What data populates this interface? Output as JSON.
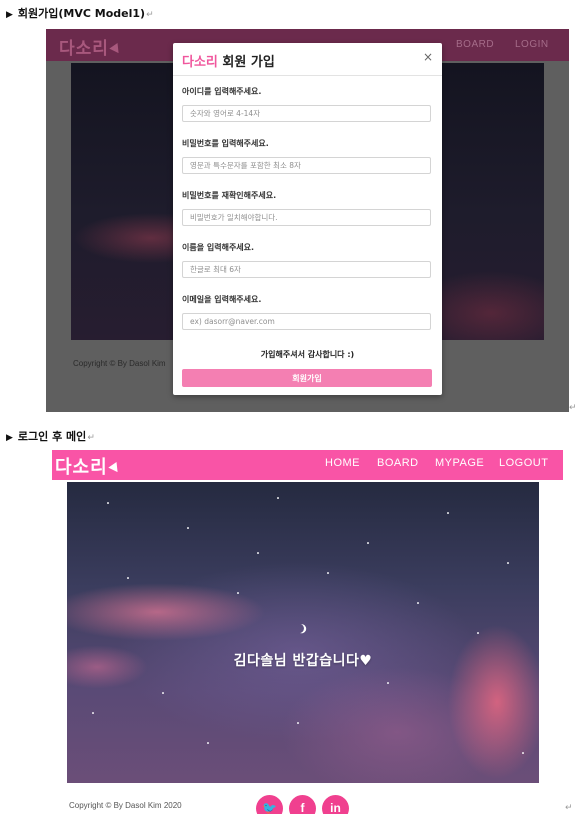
{
  "sections": {
    "signup_heading": "회원가입(MVC Model1)",
    "main_heading": "로그인 후 메인"
  },
  "paragraph_mark": "↵",
  "signup_shot": {
    "logo": "다소리",
    "nav": [
      "BOARD",
      "LOGIN"
    ],
    "copyright": "Copyright © By Dasol Kim",
    "modal": {
      "title_brand": "다소리",
      "title_rest": " 회원 가입",
      "close": "×",
      "fields": [
        {
          "label": "아이디를 입력해주세요.",
          "placeholder": "숫자와 영어로 4-14자"
        },
        {
          "label": "비밀번호를 입력해주세요.",
          "placeholder": "영문과 특수문자를 포함한 최소 8자"
        },
        {
          "label": "비밀번호를 재확인해주세요.",
          "placeholder": "비밀번호가 일치해야합니다."
        },
        {
          "label": "이름을 입력해주세요.",
          "placeholder": "한글로 최대 6자"
        },
        {
          "label": "이메일을 입력해주세요.",
          "placeholder": "ex) dasorr@naver.com"
        }
      ],
      "thanks": "가입해주셔서 감사합니다 :)",
      "submit": "회원가입"
    }
  },
  "main_shot": {
    "logo": "다소리",
    "nav": [
      "HOME",
      "BOARD",
      "MYPAGE",
      "LOGOUT"
    ],
    "greeting": "김다솔님 반갑습니다♥",
    "copyright": "Copyright © By Dasol Kim 2020",
    "social": [
      "twitter-icon",
      "facebook-icon",
      "linkedin-icon"
    ],
    "social_glyphs": [
      "🐦",
      "f",
      "in"
    ]
  },
  "colors": {
    "brand_pink": "#f954a6",
    "button_pink": "#f47fb2",
    "social_pink": "#f0408f"
  }
}
